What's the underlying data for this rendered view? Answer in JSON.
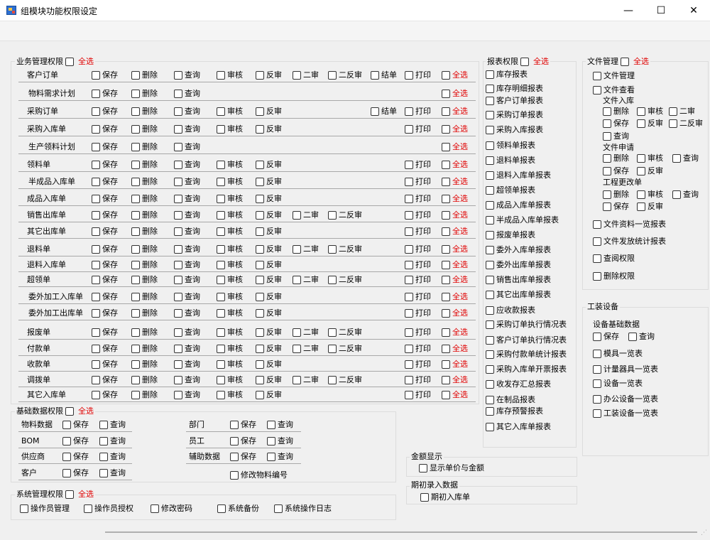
{
  "window": {
    "title": "组模块功能权限设定",
    "min": "—",
    "max": "☐",
    "close": "✕"
  },
  "labels": {
    "save": "保存",
    "delete": "删除",
    "query": "查询",
    "audit": "审核",
    "unaudit": "反审",
    "second": "二审",
    "unsecond": "二反审",
    "close": "结单",
    "print": "打印",
    "all": "全选",
    "modify_code": "修改物料编号",
    "show_price": "显示单价与金额",
    "init_in": "期初入库单"
  },
  "groups": {
    "business": "业务管理权限",
    "report": "报表权限",
    "file": "文件管理",
    "base": "基础数据权限",
    "system": "系统管理权限",
    "amount": "金额显示",
    "init": "期初录入数据",
    "equip": "工装设备"
  },
  "business_rows": [
    {
      "name": "客户订单",
      "items": [
        "save",
        "delete",
        "query",
        "audit",
        "unaudit",
        "second",
        "unsecond",
        "close",
        "print",
        "all"
      ]
    },
    {
      "name": "物料需求计划",
      "items": [
        "save",
        "delete",
        "query",
        "all"
      ]
    },
    {
      "name": "采购订单",
      "items": [
        "save",
        "delete",
        "query",
        "audit",
        "unaudit",
        "close",
        "print",
        "all"
      ]
    },
    {
      "name": "采购入库单",
      "items": [
        "save",
        "delete",
        "query",
        "audit",
        "unaudit",
        "print",
        "all"
      ]
    },
    {
      "name": "生产领料计划",
      "items": [
        "save",
        "delete",
        "query",
        "all"
      ]
    },
    {
      "name": "领料单",
      "items": [
        "save",
        "delete",
        "query",
        "audit",
        "unaudit",
        "print",
        "all"
      ]
    },
    {
      "name": "半成品入库单",
      "items": [
        "save",
        "delete",
        "query",
        "audit",
        "unaudit",
        "print",
        "all"
      ]
    },
    {
      "name": "成品入库单",
      "items": [
        "save",
        "delete",
        "query",
        "audit",
        "unaudit",
        "print",
        "all"
      ]
    },
    {
      "name": "销售出库单",
      "items": [
        "save",
        "delete",
        "query",
        "audit",
        "unaudit",
        "second",
        "unsecond",
        "print",
        "all"
      ]
    },
    {
      "name": "其它出库单",
      "items": [
        "save",
        "delete",
        "query",
        "audit",
        "unaudit",
        "print",
        "all"
      ]
    },
    {
      "name": "退料单",
      "items": [
        "save",
        "delete",
        "query",
        "audit",
        "unaudit",
        "second",
        "unsecond",
        "print",
        "all"
      ]
    },
    {
      "name": "退料入库单",
      "items": [
        "save",
        "delete",
        "query",
        "audit",
        "unaudit",
        "print",
        "all"
      ]
    },
    {
      "name": "超领单",
      "items": [
        "save",
        "delete",
        "query",
        "audit",
        "unaudit",
        "second",
        "unsecond",
        "print",
        "all"
      ]
    },
    {
      "name": "委外加工入库单",
      "items": [
        "save",
        "delete",
        "query",
        "audit",
        "unaudit",
        "print",
        "all"
      ]
    },
    {
      "name": "委外加工出库单",
      "items": [
        "save",
        "delete",
        "query",
        "audit",
        "unaudit",
        "print",
        "all"
      ]
    },
    {
      "name": "报废单",
      "items": [
        "save",
        "delete",
        "query",
        "audit",
        "unaudit",
        "second",
        "unsecond",
        "print",
        "all"
      ]
    },
    {
      "name": "付款单",
      "items": [
        "save",
        "delete",
        "query",
        "audit",
        "unaudit",
        "second",
        "unsecond",
        "print",
        "all"
      ]
    },
    {
      "name": "收款单",
      "items": [
        "save",
        "delete",
        "query",
        "audit",
        "unaudit",
        "print",
        "all"
      ]
    },
    {
      "name": "调拨单",
      "items": [
        "save",
        "delete",
        "query",
        "audit",
        "unaudit",
        "second",
        "unsecond",
        "print",
        "all"
      ]
    },
    {
      "name": "其它入库单",
      "items": [
        "save",
        "delete",
        "query",
        "audit",
        "unaudit",
        "print",
        "all"
      ]
    }
  ],
  "reports": [
    "库存报表",
    "库存明细报表",
    "客户订单报表",
    "采购订单报表",
    "采购入库报表",
    "领料单报表",
    "退料单报表",
    "退料入库单报表",
    "超领单报表",
    "成品入库单报表",
    "半成品入库单报表",
    "报废单报表",
    "委外入库单报表",
    "委外出库单报表",
    "销售出库单报表",
    "其它出库单报表",
    "应收款报表",
    "采购订单执行情况表",
    "客户订单执行情况表",
    "采购付款单统计报表",
    "采购入库单开票报表",
    "收发存汇总报表",
    "在制品报表",
    "库存预警报表",
    "其它入库单报表"
  ],
  "file": {
    "mgmt": "文件管理",
    "view": "文件查看",
    "in_title": "文件入库",
    "apply_title": "文件申请",
    "eng_title": "工程更改单",
    "in_items": [
      "删除",
      "审核",
      "二审",
      "保存",
      "反审",
      "二反审",
      "查询"
    ],
    "apply_items": [
      "删除",
      "审核",
      "查询",
      "保存",
      "反审"
    ],
    "eng_items": [
      "删除",
      "审核",
      "查询",
      "保存",
      "反审"
    ],
    "others": [
      "文件资料一览报表",
      "文件发放统计报表",
      "查阅权限",
      "删除权限"
    ]
  },
  "equip": {
    "base_title": "设备基础数据",
    "base_items": [
      "保存",
      "查询"
    ],
    "list": [
      "模具一览表",
      "计量器具一览表",
      "设备一览表",
      "办公设备一览表",
      "工装设备一览表"
    ]
  },
  "base": {
    "rows": [
      [
        "物料数据",
        "部门"
      ],
      [
        "BOM",
        "员工"
      ],
      [
        "供应商",
        "辅助数据"
      ],
      [
        "客户"
      ]
    ]
  },
  "system": [
    "操作员管理",
    "操作员授权",
    "修改密码",
    "系统备份",
    "系统操作日志"
  ]
}
